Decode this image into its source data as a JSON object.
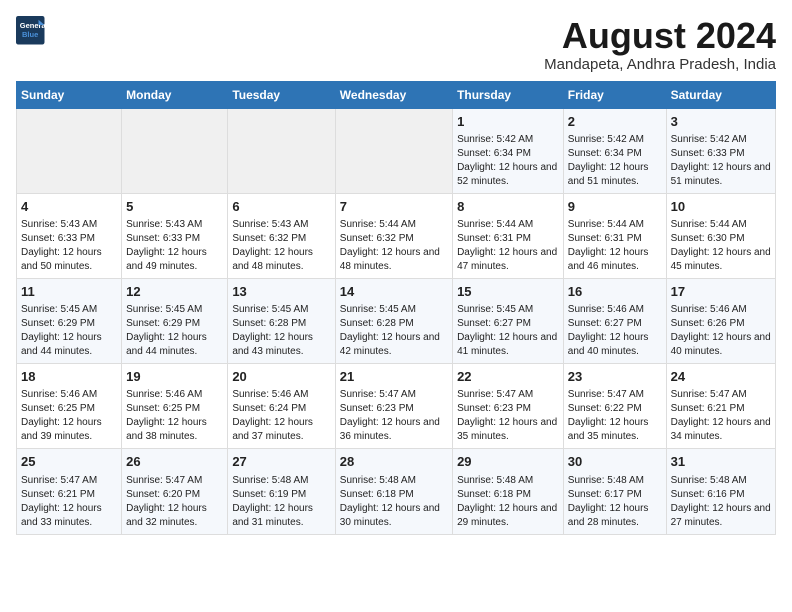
{
  "header": {
    "logo_line1": "General",
    "logo_line2": "Blue",
    "main_title": "August 2024",
    "subtitle": "Mandapeta, Andhra Pradesh, India"
  },
  "days_of_week": [
    "Sunday",
    "Monday",
    "Tuesday",
    "Wednesday",
    "Thursday",
    "Friday",
    "Saturday"
  ],
  "weeks": [
    [
      {
        "day": "",
        "sunrise": "",
        "sunset": "",
        "daylight": ""
      },
      {
        "day": "",
        "sunrise": "",
        "sunset": "",
        "daylight": ""
      },
      {
        "day": "",
        "sunrise": "",
        "sunset": "",
        "daylight": ""
      },
      {
        "day": "",
        "sunrise": "",
        "sunset": "",
        "daylight": ""
      },
      {
        "day": "1",
        "sunrise": "Sunrise: 5:42 AM",
        "sunset": "Sunset: 6:34 PM",
        "daylight": "Daylight: 12 hours and 52 minutes."
      },
      {
        "day": "2",
        "sunrise": "Sunrise: 5:42 AM",
        "sunset": "Sunset: 6:34 PM",
        "daylight": "Daylight: 12 hours and 51 minutes."
      },
      {
        "day": "3",
        "sunrise": "Sunrise: 5:42 AM",
        "sunset": "Sunset: 6:33 PM",
        "daylight": "Daylight: 12 hours and 51 minutes."
      }
    ],
    [
      {
        "day": "4",
        "sunrise": "Sunrise: 5:43 AM",
        "sunset": "Sunset: 6:33 PM",
        "daylight": "Daylight: 12 hours and 50 minutes."
      },
      {
        "day": "5",
        "sunrise": "Sunrise: 5:43 AM",
        "sunset": "Sunset: 6:33 PM",
        "daylight": "Daylight: 12 hours and 49 minutes."
      },
      {
        "day": "6",
        "sunrise": "Sunrise: 5:43 AM",
        "sunset": "Sunset: 6:32 PM",
        "daylight": "Daylight: 12 hours and 48 minutes."
      },
      {
        "day": "7",
        "sunrise": "Sunrise: 5:44 AM",
        "sunset": "Sunset: 6:32 PM",
        "daylight": "Daylight: 12 hours and 48 minutes."
      },
      {
        "day": "8",
        "sunrise": "Sunrise: 5:44 AM",
        "sunset": "Sunset: 6:31 PM",
        "daylight": "Daylight: 12 hours and 47 minutes."
      },
      {
        "day": "9",
        "sunrise": "Sunrise: 5:44 AM",
        "sunset": "Sunset: 6:31 PM",
        "daylight": "Daylight: 12 hours and 46 minutes."
      },
      {
        "day": "10",
        "sunrise": "Sunrise: 5:44 AM",
        "sunset": "Sunset: 6:30 PM",
        "daylight": "Daylight: 12 hours and 45 minutes."
      }
    ],
    [
      {
        "day": "11",
        "sunrise": "Sunrise: 5:45 AM",
        "sunset": "Sunset: 6:29 PM",
        "daylight": "Daylight: 12 hours and 44 minutes."
      },
      {
        "day": "12",
        "sunrise": "Sunrise: 5:45 AM",
        "sunset": "Sunset: 6:29 PM",
        "daylight": "Daylight: 12 hours and 44 minutes."
      },
      {
        "day": "13",
        "sunrise": "Sunrise: 5:45 AM",
        "sunset": "Sunset: 6:28 PM",
        "daylight": "Daylight: 12 hours and 43 minutes."
      },
      {
        "day": "14",
        "sunrise": "Sunrise: 5:45 AM",
        "sunset": "Sunset: 6:28 PM",
        "daylight": "Daylight: 12 hours and 42 minutes."
      },
      {
        "day": "15",
        "sunrise": "Sunrise: 5:45 AM",
        "sunset": "Sunset: 6:27 PM",
        "daylight": "Daylight: 12 hours and 41 minutes."
      },
      {
        "day": "16",
        "sunrise": "Sunrise: 5:46 AM",
        "sunset": "Sunset: 6:27 PM",
        "daylight": "Daylight: 12 hours and 40 minutes."
      },
      {
        "day": "17",
        "sunrise": "Sunrise: 5:46 AM",
        "sunset": "Sunset: 6:26 PM",
        "daylight": "Daylight: 12 hours and 40 minutes."
      }
    ],
    [
      {
        "day": "18",
        "sunrise": "Sunrise: 5:46 AM",
        "sunset": "Sunset: 6:25 PM",
        "daylight": "Daylight: 12 hours and 39 minutes."
      },
      {
        "day": "19",
        "sunrise": "Sunrise: 5:46 AM",
        "sunset": "Sunset: 6:25 PM",
        "daylight": "Daylight: 12 hours and 38 minutes."
      },
      {
        "day": "20",
        "sunrise": "Sunrise: 5:46 AM",
        "sunset": "Sunset: 6:24 PM",
        "daylight": "Daylight: 12 hours and 37 minutes."
      },
      {
        "day": "21",
        "sunrise": "Sunrise: 5:47 AM",
        "sunset": "Sunset: 6:23 PM",
        "daylight": "Daylight: 12 hours and 36 minutes."
      },
      {
        "day": "22",
        "sunrise": "Sunrise: 5:47 AM",
        "sunset": "Sunset: 6:23 PM",
        "daylight": "Daylight: 12 hours and 35 minutes."
      },
      {
        "day": "23",
        "sunrise": "Sunrise: 5:47 AM",
        "sunset": "Sunset: 6:22 PM",
        "daylight": "Daylight: 12 hours and 35 minutes."
      },
      {
        "day": "24",
        "sunrise": "Sunrise: 5:47 AM",
        "sunset": "Sunset: 6:21 PM",
        "daylight": "Daylight: 12 hours and 34 minutes."
      }
    ],
    [
      {
        "day": "25",
        "sunrise": "Sunrise: 5:47 AM",
        "sunset": "Sunset: 6:21 PM",
        "daylight": "Daylight: 12 hours and 33 minutes."
      },
      {
        "day": "26",
        "sunrise": "Sunrise: 5:47 AM",
        "sunset": "Sunset: 6:20 PM",
        "daylight": "Daylight: 12 hours and 32 minutes."
      },
      {
        "day": "27",
        "sunrise": "Sunrise: 5:48 AM",
        "sunset": "Sunset: 6:19 PM",
        "daylight": "Daylight: 12 hours and 31 minutes."
      },
      {
        "day": "28",
        "sunrise": "Sunrise: 5:48 AM",
        "sunset": "Sunset: 6:18 PM",
        "daylight": "Daylight: 12 hours and 30 minutes."
      },
      {
        "day": "29",
        "sunrise": "Sunrise: 5:48 AM",
        "sunset": "Sunset: 6:18 PM",
        "daylight": "Daylight: 12 hours and 29 minutes."
      },
      {
        "day": "30",
        "sunrise": "Sunrise: 5:48 AM",
        "sunset": "Sunset: 6:17 PM",
        "daylight": "Daylight: 12 hours and 28 minutes."
      },
      {
        "day": "31",
        "sunrise": "Sunrise: 5:48 AM",
        "sunset": "Sunset: 6:16 PM",
        "daylight": "Daylight: 12 hours and 27 minutes."
      }
    ]
  ]
}
